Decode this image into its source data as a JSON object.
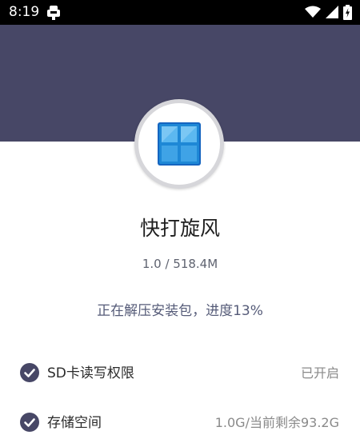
{
  "status_bar": {
    "time": "8:19",
    "icons": [
      "bug-notification-icon",
      "wifi-icon",
      "cellular-signal-icon",
      "battery-charging-icon"
    ]
  },
  "colors": {
    "header": "#474766",
    "check": "#474766",
    "logo_blue": "#1e88d6"
  },
  "app": {
    "name": "快打旋风",
    "version_size": "1.0 / 518.4M",
    "progress_text": "正在解压安装包，进度13%",
    "progress_percent": 13
  },
  "checks": [
    {
      "label": "SD卡读写权限",
      "value": "已开启"
    },
    {
      "label": "存储空间",
      "value": "1.0G/当前剩余93.2G"
    }
  ]
}
